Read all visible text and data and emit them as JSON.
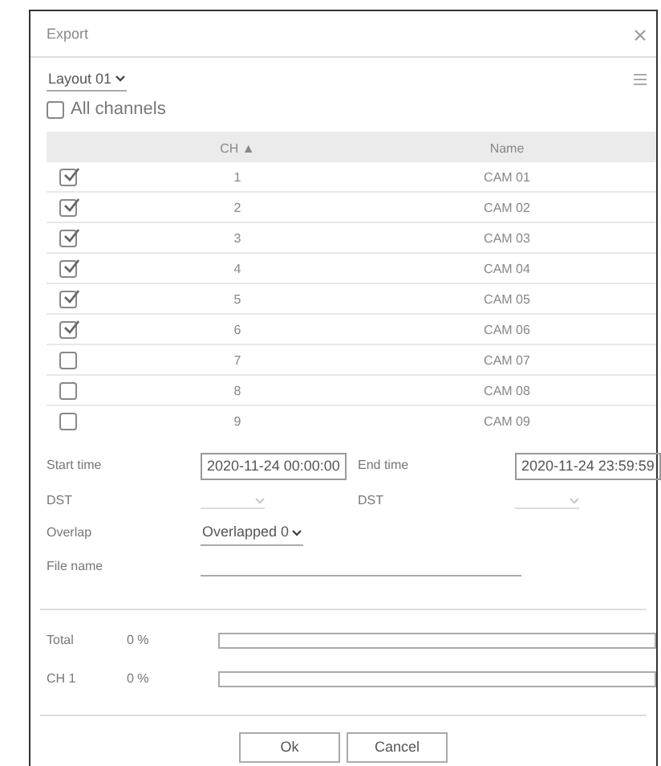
{
  "dialog": {
    "title": "Export",
    "layout": "Layout 01",
    "all_channels": {
      "label": "All channels",
      "checked": false
    }
  },
  "table": {
    "columns": [
      "CH",
      "Name"
    ],
    "sort_mark": "▲",
    "rows": [
      {
        "ch": "1",
        "name": "CAM 01",
        "checked": true
      },
      {
        "ch": "2",
        "name": "CAM 02",
        "checked": true
      },
      {
        "ch": "3",
        "name": "CAM 03",
        "checked": true
      },
      {
        "ch": "4",
        "name": "CAM 04",
        "checked": true
      },
      {
        "ch": "5",
        "name": "CAM 05",
        "checked": true
      },
      {
        "ch": "6",
        "name": "CAM 06",
        "checked": true
      },
      {
        "ch": "7",
        "name": "CAM 07",
        "checked": false
      },
      {
        "ch": "8",
        "name": "CAM 08",
        "checked": false
      },
      {
        "ch": "9",
        "name": "CAM 09",
        "checked": false
      }
    ]
  },
  "form": {
    "start_label": "Start time",
    "start_value": "2020-11-24 00:00:00",
    "end_label": "End time",
    "end_value": "2020-11-24 23:59:59",
    "dst_label": "DST",
    "dst_label_2": "DST",
    "dst_disabled": true,
    "overlap_label": "Overlap",
    "overlap_value": "Overlapped 0",
    "file_label": "File name"
  },
  "progress": [
    {
      "label": "Total",
      "reading": "0 %",
      "level": 0
    },
    {
      "label": "CH 1",
      "reading": "0 %",
      "level": 0
    }
  ],
  "buttons": [
    "Ok",
    "Cancel"
  ]
}
